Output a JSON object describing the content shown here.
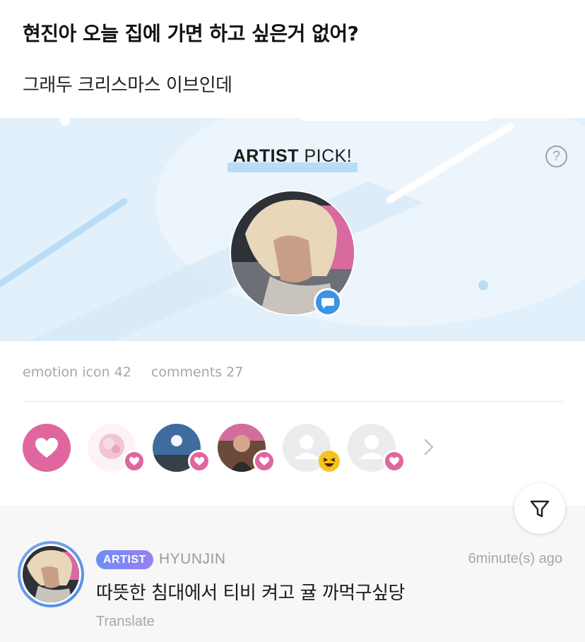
{
  "post": {
    "title": "현진아 오늘 집에 가면 하고 싶은거 없어?",
    "body": "그래두 크리스마스 이브인데"
  },
  "artist_pick": {
    "title_bold": "ARTIST",
    "title_rest": " PICK!",
    "help_label": "?",
    "badge_icon": "chat-bubble-icon",
    "background_color": "#e2f0fb",
    "accent_color": "#3a95e4"
  },
  "stats": {
    "emotion": "emotion icon 42",
    "comments": "comments 27"
  },
  "reactions": {
    "main_icon": "heart-icon",
    "main_color": "#e0669f",
    "users": [
      {
        "avatar": "photo-pink-flower",
        "reaction": "heart-icon"
      },
      {
        "avatar": "photo-sky",
        "reaction": "heart-icon"
      },
      {
        "avatar": "photo-performer",
        "reaction": "heart-icon"
      },
      {
        "avatar": "default-user",
        "reaction": "laughing-emoji-icon"
      },
      {
        "avatar": "default-user",
        "reaction": "heart-icon"
      }
    ],
    "more_icon": "chevron-right-icon"
  },
  "filter": {
    "icon": "filter-funnel-icon"
  },
  "comment": {
    "badge": "ARTIST",
    "author": "HYUNJIN",
    "time": "6minute(s) ago",
    "text": "따뜻한 침대에서 티비 켜고 귤 까먹구싶당",
    "translate": "Translate"
  }
}
